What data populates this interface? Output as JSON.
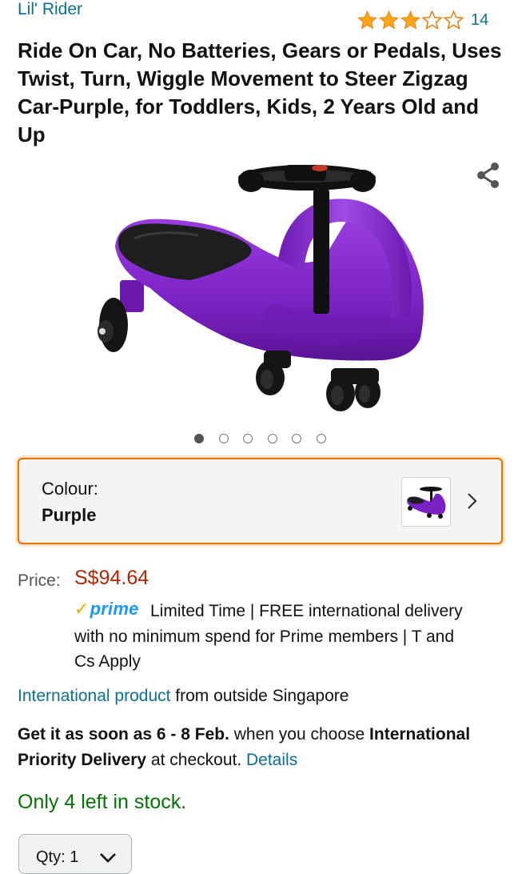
{
  "product": {
    "brand": "Lil' Rider",
    "rating": {
      "stars": 3,
      "out_of": 5,
      "count": "14"
    },
    "title": "Ride On Car, No Batteries, Gears or Pedals, Uses Twist, Turn, Wiggle Movement to Steer Zigzag Car-Purple, for Toddlers, Kids, 2 Years Old and Up",
    "image_dots": {
      "total": 6,
      "active": 0
    }
  },
  "variant": {
    "label": "Colour:",
    "value": "Purple",
    "thumb_color": "#8a2be2"
  },
  "price": {
    "label": "Price:",
    "value": "S$94.64"
  },
  "prime": {
    "logo": "prime",
    "text": "Limited Time | FREE international delivery with no minimum spend for Prime members | T and Cs Apply"
  },
  "international": {
    "link": "International product",
    "suffix": " from outside Singapore"
  },
  "delivery": {
    "prefix": "Get it as soon as 6 - 8 Feb.",
    "middle": " when you choose ",
    "method": "International Priority Delivery",
    "suffix": " at checkout. ",
    "details_link": "Details"
  },
  "stock": "Only 4 left in stock.",
  "quantity": {
    "label": "Qty:",
    "value": "1"
  },
  "colors": {
    "link": "#0b6e99",
    "price": "#b12704",
    "star": "#ffa41c",
    "stock": "#007600",
    "focus_border": "#e77600",
    "product_purple": "#7b22c4"
  },
  "icons": [
    "star-filled-icon",
    "star-empty-icon",
    "share-icon",
    "chevron-right-icon",
    "chevron-down-icon"
  ]
}
